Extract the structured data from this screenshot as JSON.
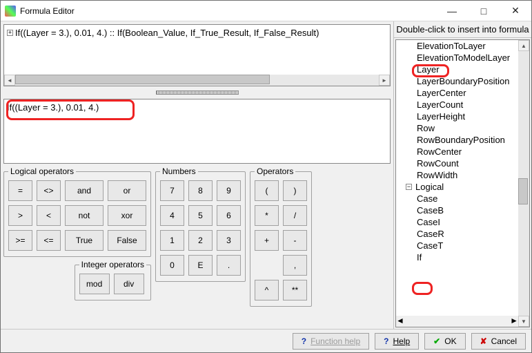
{
  "window": {
    "title": "Formula Editor"
  },
  "parsed": {
    "text": "If((Layer = 3.), 0.01, 4.)  :: If(Boolean_Value, If_True_Result, If_False_Result)"
  },
  "edit": {
    "text": "If((Layer = 3.), 0.01, 4.)"
  },
  "groups": {
    "logical": "Logical operators",
    "integer": "Integer operators",
    "numbers": "Numbers",
    "operators": "Operators"
  },
  "logic": {
    "eq": "=",
    "ne": "<>",
    "and": "and",
    "or": "or",
    "gt": ">",
    "lt": "<",
    "not": "not",
    "xor": "xor",
    "ge": ">=",
    "le": "<=",
    "true": "True",
    "false": "False"
  },
  "intops": {
    "mod": "mod",
    "div": "div"
  },
  "nums": {
    "7": "7",
    "8": "8",
    "9": "9",
    "4": "4",
    "5": "5",
    "6": "6",
    "1": "1",
    "2": "2",
    "3": "3",
    "0": "0",
    "E": "E",
    "dot": "."
  },
  "ops": {
    "lp": "(",
    "rp": ")",
    "mul": "*",
    "div": "/",
    "add": "+",
    "sub": "-",
    "pwc": "^",
    "pws": "**",
    "cma": ","
  },
  "right": {
    "header": "Double-click to insert into formula",
    "logical_label": "Logical",
    "items_gis": [
      "ElevationToLayer",
      "ElevationToModelLayer",
      "Layer",
      "LayerBoundaryPosition",
      "LayerCenter",
      "LayerCount",
      "LayerHeight",
      "Row",
      "RowBoundaryPosition",
      "RowCenter",
      "RowCount",
      "RowWidth"
    ],
    "items_logical": [
      "Case",
      "CaseB",
      "CaseI",
      "CaseR",
      "CaseT",
      "If"
    ]
  },
  "footer": {
    "funchelp": "Function help",
    "help": "Help",
    "ok": "OK",
    "cancel": "Cancel"
  }
}
